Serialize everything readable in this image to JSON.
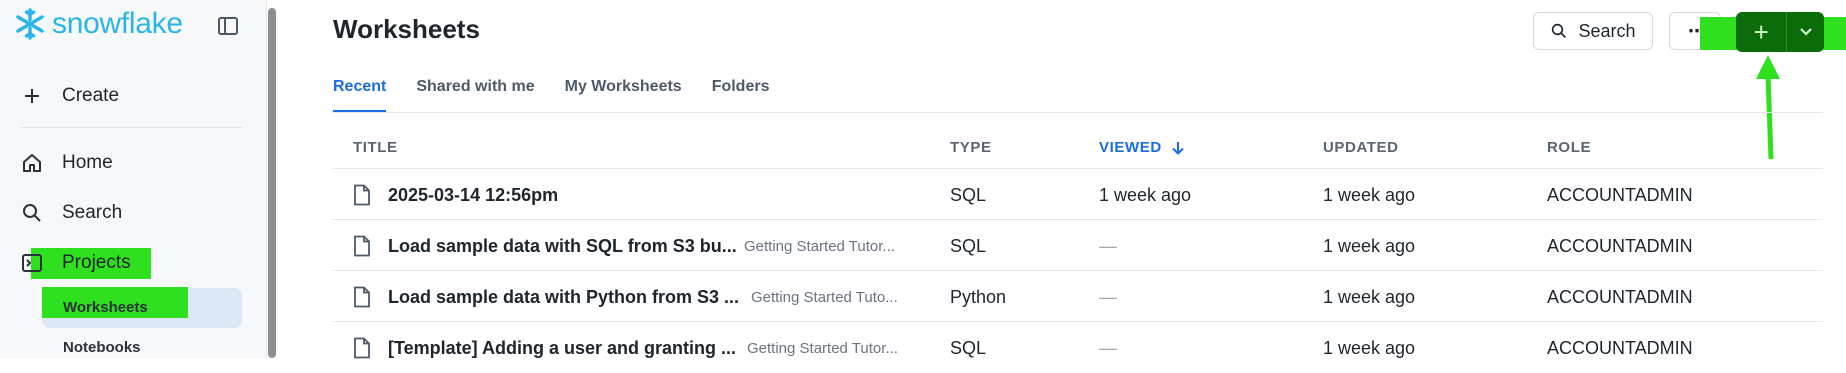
{
  "colors": {
    "accent": "#1a6ce0",
    "brand": "#29b5e8",
    "highlight": "#2fe01e",
    "new_button": "#0a6d0a"
  },
  "sidebar": {
    "logo_text": "snowflake",
    "create_label": "Create",
    "items": [
      {
        "label": "Home",
        "icon": "home-icon"
      },
      {
        "label": "Search",
        "icon": "search-icon"
      },
      {
        "label": "Projects",
        "icon": "projects-icon"
      }
    ],
    "sub_items": [
      {
        "label": "Worksheets",
        "active": true
      },
      {
        "label": "Notebooks",
        "active": false
      }
    ]
  },
  "header": {
    "title": "Worksheets",
    "search_label": "Search",
    "more_label": "⋯"
  },
  "tabs": [
    {
      "label": "Recent",
      "active": true
    },
    {
      "label": "Shared with me",
      "active": false
    },
    {
      "label": "My Worksheets",
      "active": false
    },
    {
      "label": "Folders",
      "active": false
    }
  ],
  "table": {
    "columns": [
      "TITLE",
      "TYPE",
      "VIEWED",
      "UPDATED",
      "ROLE"
    ],
    "sorted_column": "VIEWED",
    "rows": [
      {
        "title": "2025-03-14 12:56pm",
        "folder": "",
        "type": "SQL",
        "viewed": "1 week ago",
        "updated": "1 week ago",
        "role": "ACCOUNTADMIN"
      },
      {
        "title": "Load sample data with SQL from S3 bu...",
        "folder": "Getting Started Tutor...",
        "type": "SQL",
        "viewed": "—",
        "updated": "1 week ago",
        "role": "ACCOUNTADMIN"
      },
      {
        "title": "Load sample data with Python from S3 ...",
        "folder": "Getting Started Tuto...",
        "type": "Python",
        "viewed": "—",
        "updated": "1 week ago",
        "role": "ACCOUNTADMIN"
      },
      {
        "title": "[Template] Adding a user and granting ...",
        "folder": "Getting Started Tutor...",
        "type": "SQL",
        "viewed": "—",
        "updated": "1 week ago",
        "role": "ACCOUNTADMIN"
      }
    ]
  }
}
